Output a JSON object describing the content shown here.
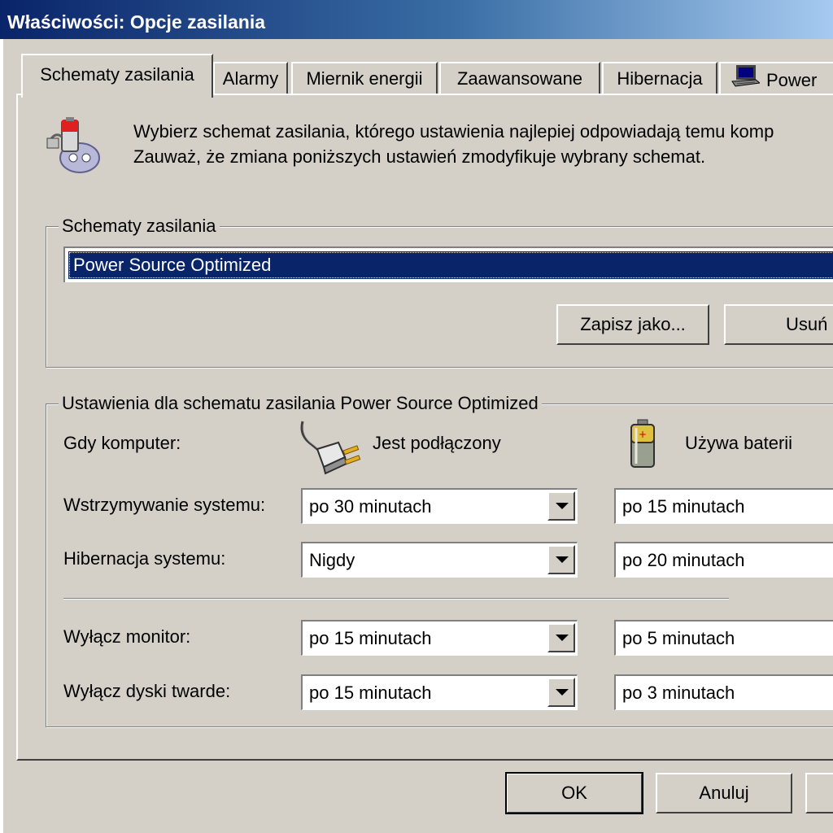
{
  "window": {
    "title": "Właściwości: Opcje zasilania"
  },
  "tabs": [
    {
      "label": "Schematy zasilania"
    },
    {
      "label": "Alarmy"
    },
    {
      "label": "Miernik energii"
    },
    {
      "label": "Zaawansowane"
    },
    {
      "label": "Hibernacja"
    },
    {
      "label": "Power"
    }
  ],
  "description": {
    "line1": "Wybierz schemat zasilania, którego ustawienia najlepiej odpowiadają temu komp",
    "line2": "Zauważ, że zmiana poniższych ustawień zmodyfikuje wybrany schemat."
  },
  "schemes": {
    "legend": "Schematy zasilania",
    "selected": "Power Source Optimized",
    "save_button": "Zapisz jako...",
    "delete_button": "Usuń"
  },
  "settings": {
    "legend": "Ustawienia dla schematu zasilania Power Source Optimized",
    "when_label": "Gdy komputer:",
    "plugged_label": "Jest podłączony",
    "battery_label": "Używa baterii",
    "rows": [
      {
        "label": "Wstrzymywanie systemu:",
        "plugged": "po 30 minutach",
        "battery": "po 15 minutach"
      },
      {
        "label": "Hibernacja systemu:",
        "plugged": "Nigdy",
        "battery": "po 20 minutach"
      },
      {
        "label": "Wyłącz monitor:",
        "plugged": "po 15 minutach",
        "battery": "po 5 minutach"
      },
      {
        "label": "Wyłącz dyski twarde:",
        "plugged": "po 15 minutach",
        "battery": "po 3 minutach"
      }
    ]
  },
  "footer": {
    "ok": "OK",
    "cancel": "Anuluj"
  },
  "icons": {
    "scheme": "power-scheme-icon",
    "plug": "power-plug-icon",
    "battery": "battery-icon",
    "laptop": "laptop-icon"
  }
}
